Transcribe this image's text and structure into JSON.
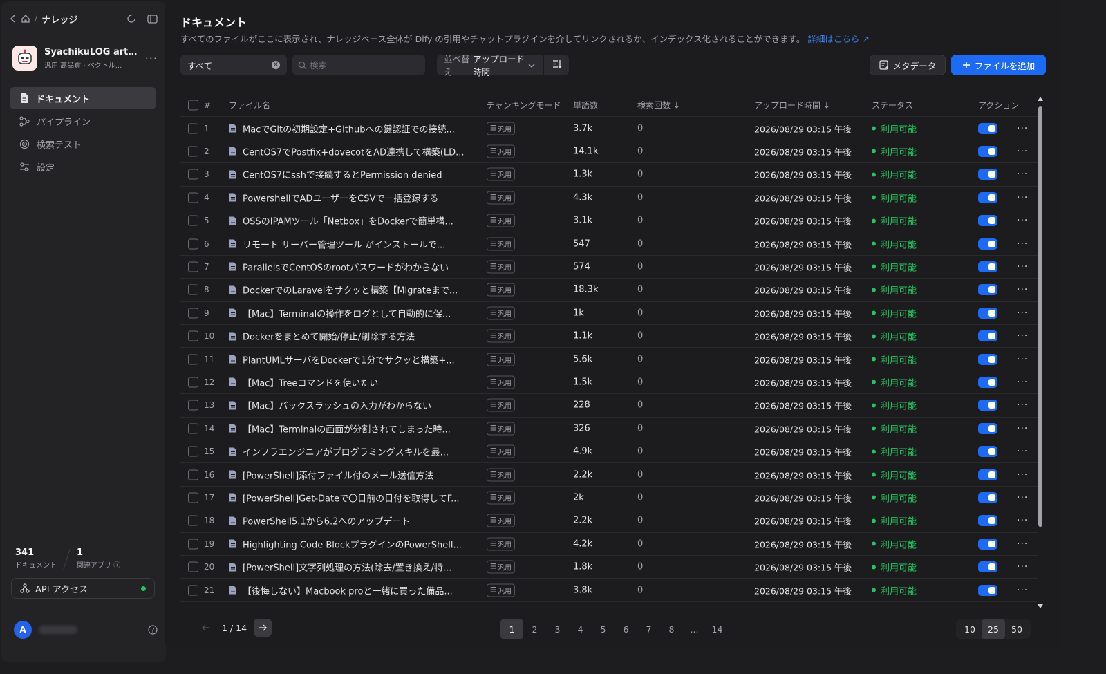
{
  "sidebar": {
    "breadcrumb": "ナレッジ",
    "knowledge": {
      "name": "SyachikuLOG arti...",
      "meta": "汎用 高品質 · ベクトル..."
    },
    "nav": [
      {
        "label": "ドキュメント",
        "icon": "document-icon",
        "active": true
      },
      {
        "label": "パイプライン",
        "icon": "pipeline-icon",
        "active": false
      },
      {
        "label": "検索テスト",
        "icon": "target-icon",
        "active": false
      },
      {
        "label": "設定",
        "icon": "settings-icon",
        "active": false
      }
    ],
    "stats": {
      "documents": "341",
      "documents_label": "ドキュメント",
      "apps": "1",
      "apps_label": "関連アプリ"
    },
    "api": {
      "label": "API アクセス",
      "status_color": "#22c55e"
    },
    "user": {
      "avatar": "A"
    }
  },
  "main": {
    "title": "ドキュメント",
    "description": "すべてのファイルがここに表示され、ナレッジベース全体が Dify の引用やチャットプラグインを介してリンクされるか、インデックス化されることができます。",
    "description_link": "詳細はこちら",
    "toolbar": {
      "filter_value": "すべて",
      "search_placeholder": "検索",
      "sort_prefix": "並べ替え",
      "sort_value": "アップロード時間",
      "metadata_label": "メタデータ",
      "add_file_label": "ファイルを追加"
    },
    "table": {
      "headers": {
        "num": "#",
        "name": "ファイル名",
        "mode": "チャンキングモード",
        "words": "単語数",
        "hits": "検索回数",
        "time": "アップロード時間",
        "status": "ステータス",
        "action": "アクション"
      },
      "mode_label": "汎用",
      "status_label": "利用可能",
      "rows": [
        {
          "n": "1",
          "name": "MacでGitの初期設定+Githubへの鍵認証での接続...",
          "words": "3.7k",
          "hits": "0",
          "time": "2026/08/29 03:15 午後"
        },
        {
          "n": "2",
          "name": "CentOS7でPostfix+dovecotをAD連携して構築(LD...",
          "words": "14.1k",
          "hits": "0",
          "time": "2026/08/29 03:15 午後"
        },
        {
          "n": "3",
          "name": "CentOS7にsshで接続するとPermission denied",
          "words": "1.3k",
          "hits": "0",
          "time": "2026/08/29 03:15 午後"
        },
        {
          "n": "4",
          "name": "PowershellでADユーザーをCSVで一括登録する",
          "words": "4.3k",
          "hits": "0",
          "time": "2026/08/29 03:15 午後"
        },
        {
          "n": "5",
          "name": "OSSのIPAMツール「Netbox」をDockerで簡単構...",
          "words": "3.1k",
          "hits": "0",
          "time": "2026/08/29 03:15 午後"
        },
        {
          "n": "6",
          "name": "リモート サーバー管理ツール がインストールで...",
          "words": "547",
          "hits": "0",
          "time": "2026/08/29 03:15 午後"
        },
        {
          "n": "7",
          "name": "ParallelsでCentOSのrootパスワードがわからない",
          "words": "574",
          "hits": "0",
          "time": "2026/08/29 03:15 午後"
        },
        {
          "n": "8",
          "name": "DockerでのLaravelをサクッと構築【Migrateまで...",
          "words": "18.3k",
          "hits": "0",
          "time": "2026/08/29 03:15 午後"
        },
        {
          "n": "9",
          "name": "【Mac】Terminalの操作をログとして自動的に保...",
          "words": "1k",
          "hits": "0",
          "time": "2026/08/29 03:15 午後"
        },
        {
          "n": "10",
          "name": "Dockerをまとめて開始/停止/削除する方法",
          "words": "1.1k",
          "hits": "0",
          "time": "2026/08/29 03:15 午後"
        },
        {
          "n": "11",
          "name": "PlantUMLサーバをDockerで1分でサクッと構築+...",
          "words": "5.6k",
          "hits": "0",
          "time": "2026/08/29 03:15 午後"
        },
        {
          "n": "12",
          "name": "【Mac】Treeコマンドを使いたい",
          "words": "1.5k",
          "hits": "0",
          "time": "2026/08/29 03:15 午後"
        },
        {
          "n": "13",
          "name": "【Mac】バックスラッシュの入力がわからない",
          "words": "228",
          "hits": "0",
          "time": "2026/08/29 03:15 午後"
        },
        {
          "n": "14",
          "name": "【Mac】Terminalの画面が分割されてしまった時...",
          "words": "326",
          "hits": "0",
          "time": "2026/08/29 03:15 午後"
        },
        {
          "n": "15",
          "name": "インフラエンジニアがプログラミングスキルを最...",
          "words": "4.9k",
          "hits": "0",
          "time": "2026/08/29 03:15 午後"
        },
        {
          "n": "16",
          "name": "[PowerShell]添付ファイル付のメール送信方法",
          "words": "2.2k",
          "hits": "0",
          "time": "2026/08/29 03:15 午後"
        },
        {
          "n": "17",
          "name": "[PowerShell]Get-Dateで〇日前の日付を取得してF...",
          "words": "2k",
          "hits": "0",
          "time": "2026/08/29 03:15 午後"
        },
        {
          "n": "18",
          "name": "PowerShell5.1から6.2へのアップデート",
          "words": "2.2k",
          "hits": "0",
          "time": "2026/08/29 03:15 午後"
        },
        {
          "n": "19",
          "name": "Highlighting Code BlockプラグインのPowerShell...",
          "words": "4.2k",
          "hits": "0",
          "time": "2026/08/29 03:15 午後"
        },
        {
          "n": "20",
          "name": "[PowerShell]文字列処理の方法(除去/置き換え/特...",
          "words": "1.8k",
          "hits": "0",
          "time": "2026/08/29 03:15 午後"
        },
        {
          "n": "21",
          "name": "【後悔しない】Macbook proと一緒に買った備品...",
          "words": "3.8k",
          "hits": "0",
          "time": "2026/08/29 03:15 午後"
        }
      ]
    },
    "pagination": {
      "count": "1 / 14",
      "pages": [
        "1",
        "2",
        "3",
        "4",
        "5",
        "6",
        "7",
        "8",
        "...",
        "14"
      ],
      "current": "1",
      "sizes": [
        "10",
        "25",
        "50"
      ],
      "current_size": "25"
    }
  },
  "colors": {
    "accent": "#1d6af5",
    "status": "#22c55e",
    "link": "#3b82f6"
  }
}
